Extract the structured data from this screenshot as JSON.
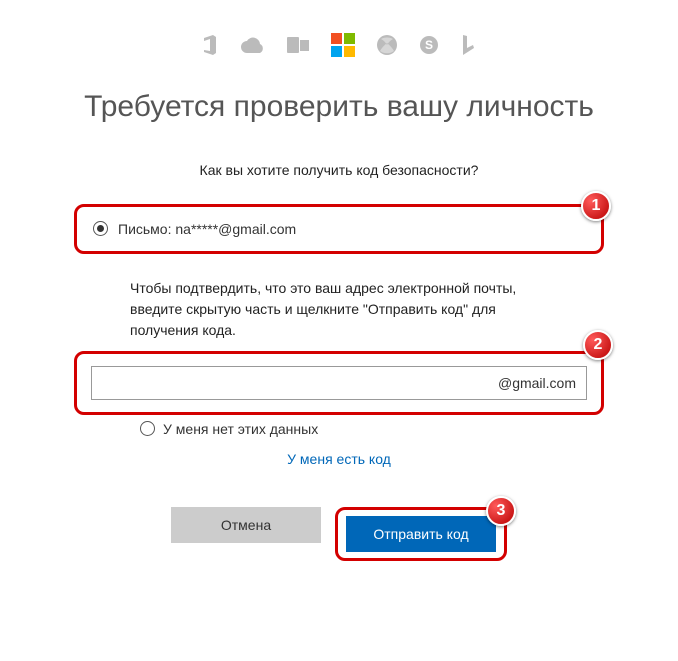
{
  "header": {
    "icons": [
      "office-icon",
      "onedrive-icon",
      "outlook-icon",
      "microsoft-logo",
      "xbox-icon",
      "skype-icon",
      "bing-icon"
    ]
  },
  "title": "Требуется проверить вашу личность",
  "prompt": "Как вы хотите получить код безопасности?",
  "option_email": {
    "label": "Письмо: na*****@gmail.com",
    "checked": true
  },
  "instructions": "Чтобы подтвердить, что это ваш адрес электронной почты, введите скрытую часть и щелкните \"Отправить код\" для получения кода.",
  "email_input": {
    "suffix": "@gmail.com",
    "value": ""
  },
  "no_data_option": {
    "label": "У меня нет этих данных",
    "checked": false
  },
  "have_code_link": "У меня есть код",
  "buttons": {
    "cancel": "Отмена",
    "submit": "Отправить код"
  },
  "annotations": {
    "badge1": "1",
    "badge2": "2",
    "badge3": "3"
  }
}
